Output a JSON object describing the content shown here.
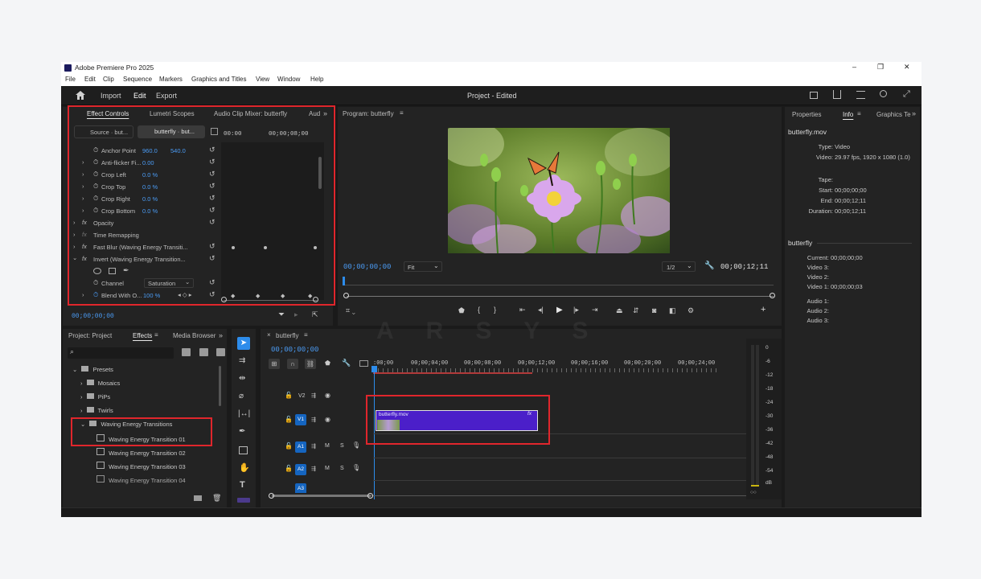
{
  "window": {
    "title": "Adobe Premiere Pro 2025",
    "min": "–",
    "max": "❐",
    "close": "✕"
  },
  "menu": [
    "File",
    "Edit",
    "Clip",
    "Sequence",
    "Markers",
    "Graphics and Titles",
    "View",
    "Window",
    "Help"
  ],
  "header": {
    "import": "Import",
    "edit": "Edit",
    "export": "Export",
    "project_title": "Project - Edited"
  },
  "effect_controls": {
    "tabs": [
      "Effect Controls",
      "Lumetri Scopes",
      "Audio Clip Mixer: butterfly",
      "Aud"
    ],
    "source_label": "Source · but...",
    "clip_label": "butterfly · but...",
    "ruler_start": "00:00",
    "ruler_mid": "00;00;08;00",
    "rows": [
      {
        "name": "Anchor Point",
        "v1": "960.0",
        "v2": "540.0"
      },
      {
        "name": "Anti-flicker Fi...",
        "v1": "0.00",
        "v2": ""
      },
      {
        "name": "Crop Left",
        "v1": "0.0 %",
        "v2": ""
      },
      {
        "name": "Crop Top",
        "v1": "0.0 %",
        "v2": ""
      },
      {
        "name": "Crop Right",
        "v1": "0.0 %",
        "v2": ""
      },
      {
        "name": "Crop Bottom",
        "v1": "0.0 %",
        "v2": ""
      }
    ],
    "fx_rows": [
      "Opacity",
      "Time Remapping",
      "Fast Blur (Waving Energy Transiti...",
      "Invert (Waving Energy Transition..."
    ],
    "channel_label": "Channel",
    "channel_value": "Saturation",
    "blend_label": "Blend With O...",
    "blend_value": "100 %",
    "timecode": "00;00;00;00"
  },
  "program": {
    "tab": "Program: butterfly",
    "timecode": "00;00;00;00",
    "fit": "Fit",
    "ratio": "1/2",
    "duration": "00;00;12;11"
  },
  "info_panel": {
    "tabs": [
      "Properties",
      "Info",
      "Graphics Te"
    ],
    "clip_name": "butterfly.mov",
    "lines": [
      {
        "k": "Type:",
        "v": "Video"
      },
      {
        "k": "Video:",
        "v": "29.97 fps, 1920 x 1080 (1.0)"
      },
      {
        "k": "Tape:",
        "v": ""
      },
      {
        "k": "Start:",
        "v": "00;00;00;00"
      },
      {
        "k": "End:",
        "v": "00;00;12;11"
      },
      {
        "k": "Duration:",
        "v": "00;00;12;11"
      }
    ],
    "seq_name": "butterfly",
    "seq_lines": [
      {
        "k": "Current:",
        "v": "00;00;00;00"
      },
      {
        "k": "Video 3:",
        "v": ""
      },
      {
        "k": "Video 2:",
        "v": ""
      },
      {
        "k": "Video 1:",
        "v": "00;00;00;03"
      },
      {
        "k": "Audio 1:",
        "v": ""
      },
      {
        "k": "Audio 2:",
        "v": ""
      },
      {
        "k": "Audio 3:",
        "v": ""
      }
    ]
  },
  "project": {
    "tabs": [
      "Project: Project",
      "Effects",
      "Media Browser"
    ],
    "tree": [
      {
        "label": "Presets",
        "level": 0,
        "open": true
      },
      {
        "label": "Mosaics",
        "level": 1,
        "open": false
      },
      {
        "label": "PiPs",
        "level": 1,
        "open": false
      },
      {
        "label": "Twirls",
        "level": 1,
        "open": false
      },
      {
        "label": "Waving Energy Transitions",
        "level": 1,
        "open": true
      },
      {
        "label": "Waving Energy Transition 01",
        "level": 2
      },
      {
        "label": "Waving Energy Transition 02",
        "level": 2
      },
      {
        "label": "Waving Energy Transition 03",
        "level": 2
      },
      {
        "label": "Waving Energy Transition 04",
        "level": 2
      }
    ]
  },
  "timeline": {
    "tab": "butterfly",
    "timecode": "00;00;00;00",
    "ruler": [
      ":00;00",
      "00;00;04;00",
      "00;00;08;00",
      "00;00;12;00",
      "00;00;16;00",
      "00;00;20;00",
      "00;00;24;00"
    ],
    "tracks": [
      {
        "id": "V2",
        "kind": "video"
      },
      {
        "id": "V1",
        "kind": "video"
      },
      {
        "id": "A1",
        "kind": "audio"
      },
      {
        "id": "A2",
        "kind": "audio"
      },
      {
        "id": "A3",
        "kind": "audio"
      }
    ],
    "clip_name": "butterfly.mov",
    "clip_fx": "fx",
    "mute": "M",
    "solo": "S"
  },
  "meter": {
    "labels": [
      "0",
      "-6",
      "-12",
      "-18",
      "-24",
      "-30",
      "-36",
      "-42",
      "-48",
      "-54",
      "dB"
    ]
  },
  "colors": {
    "accent": "#2d8ceb",
    "clip": "#4b1fc9",
    "highlight": "#e0262c",
    "track_active": "#1565c0"
  },
  "watermark": "ARSYS"
}
